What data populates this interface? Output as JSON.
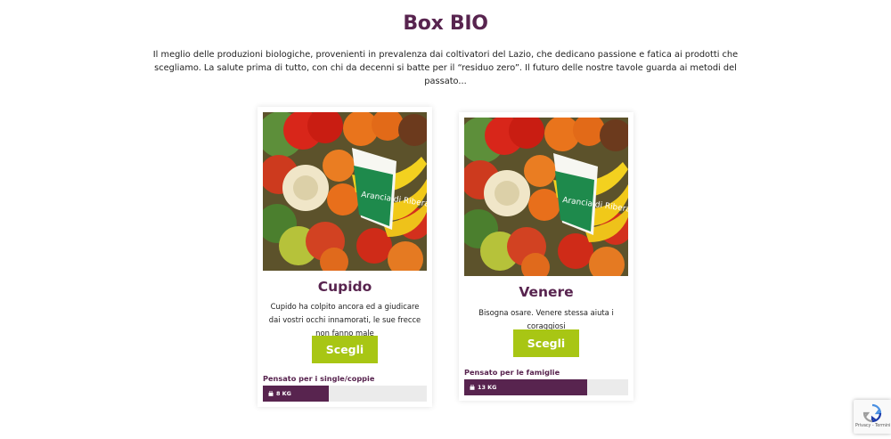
{
  "header": {
    "title": "Box BIO",
    "intro": "Il meglio delle produzioni biologiche, provenienti in prevalenza dai coltivatori del Lazio, che dedicano passione e fatica ai prodotti che scegliamo. La salute prima di tutto, con chi da decenni si batte per il “residuo zero”. Il futuro delle nostre tavole guarda ai metodi del passato..."
  },
  "boxes": [
    {
      "name": "Cupido",
      "description": "Cupido ha colpito ancora ed a giudicare dai vostri occhi innamorati, le sue frecce non fanno male",
      "button_label": "Scegli",
      "target": "Pensato per i single/coppie",
      "weight": "8 KG",
      "weight_fraction": 0.4,
      "image_label": "Arancia di Ribera D.O.P."
    },
    {
      "name": "Venere",
      "description": "Bisogna osare. Venere stessa aiuta i coraggiosi",
      "button_label": "Scegli",
      "target": "Pensato per le famiglie",
      "weight": "13 KG",
      "weight_fraction": 0.75,
      "image_label": "Arancia di Ribera D.O.P."
    }
  ],
  "recaptcha": {
    "links": "Privacy - Termini"
  },
  "colors": {
    "brand_purple": "#58244f",
    "button_green": "#a8c614",
    "bar_background": "#ebebeb"
  }
}
